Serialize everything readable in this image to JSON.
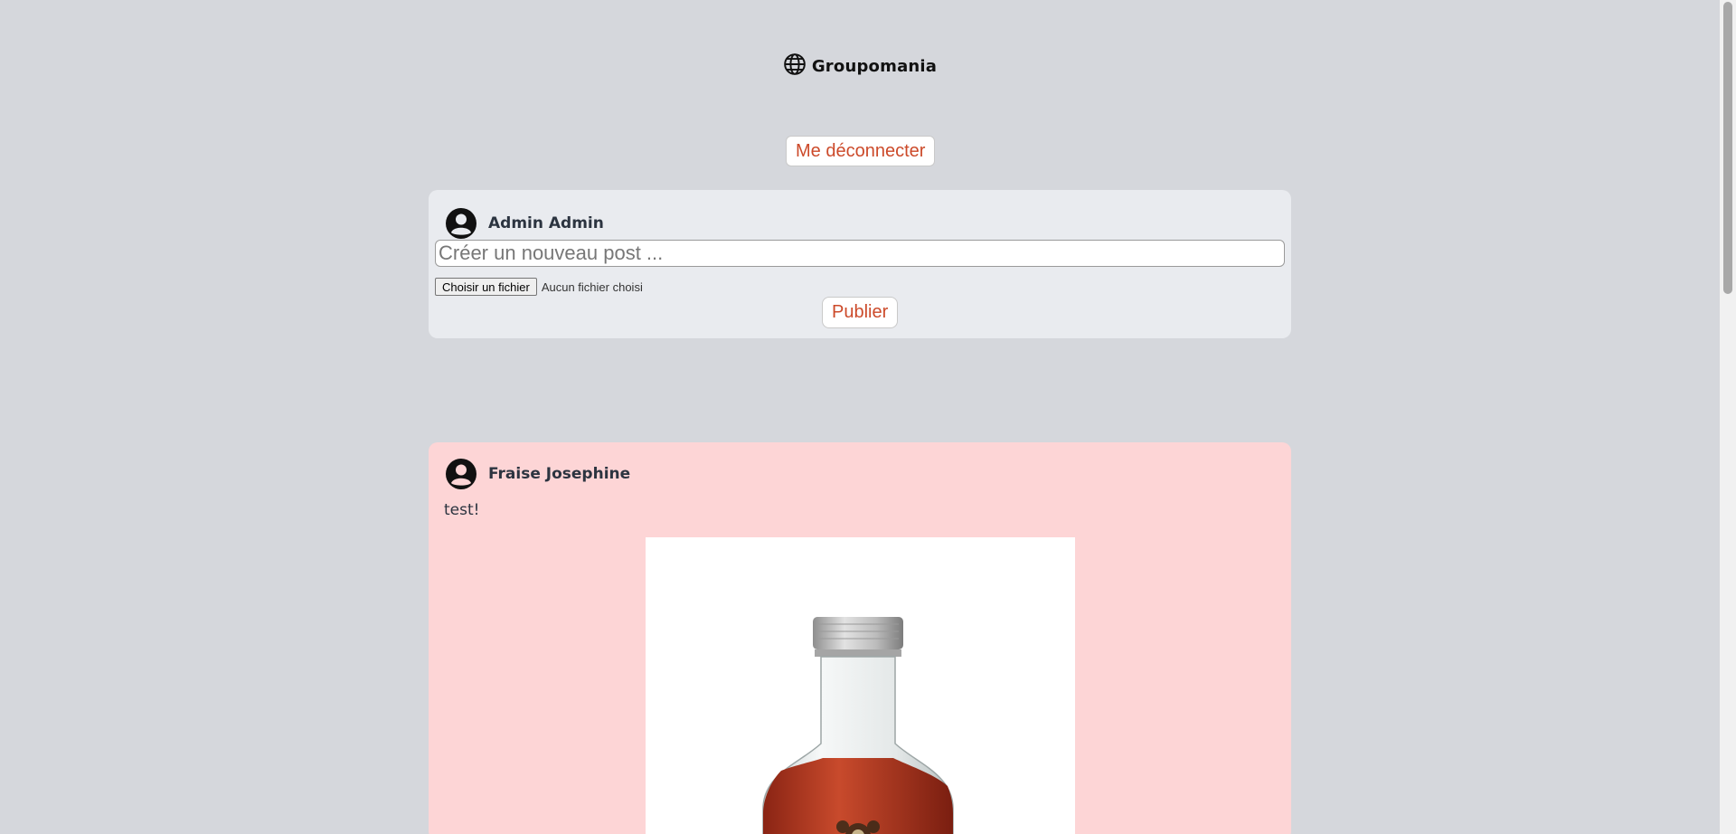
{
  "header": {
    "brand_name": "Groupomania",
    "brand_icon": "globe-icon"
  },
  "actions": {
    "logout_label": "Me déconnecter"
  },
  "composer": {
    "user_name": "Admin Admin",
    "avatar_icon": "user-circle-icon",
    "placeholder": "Créer un nouveau post ...",
    "value": "",
    "file_button_label": "Choisir un fichier",
    "file_status": "Aucun fichier choisi",
    "publish_label": "Publier"
  },
  "posts": [
    {
      "author": "Fraise Josephine",
      "avatar_icon": "user-circle-icon",
      "text": "test!",
      "image": "bottle-photo"
    }
  ],
  "colors": {
    "background": "#d5d7dc",
    "composer_card": "#e9ebef",
    "post_card": "#fdd5d6",
    "accent": "#cc4a2a"
  }
}
